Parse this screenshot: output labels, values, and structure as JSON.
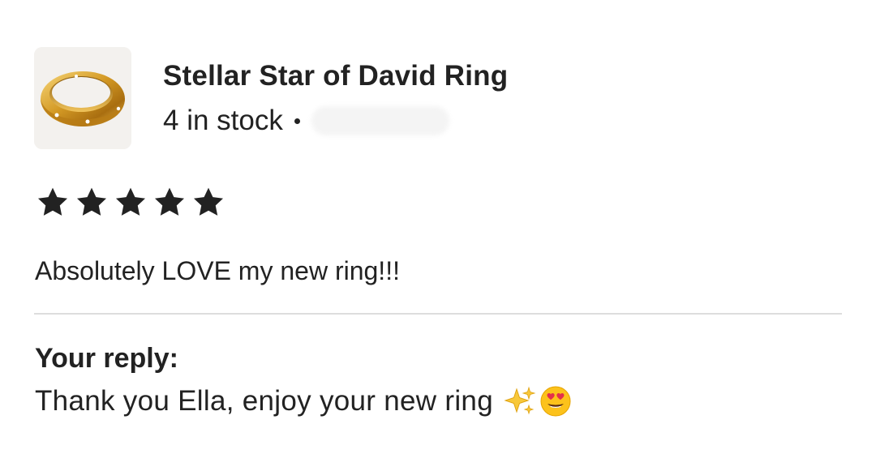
{
  "product": {
    "title": "Stellar Star of David Ring",
    "stock_text": "4 in stock",
    "image_icon": "gold-ring-icon"
  },
  "review": {
    "rating": 5,
    "max_rating": 5,
    "text": "Absolutely LOVE my new ring!!!"
  },
  "reply": {
    "heading": "Your reply:",
    "text": "Thank you Ella, enjoy your new ring",
    "emojis": [
      "sparkles-emoji",
      "heart-eyes-emoji"
    ]
  },
  "colors": {
    "text": "#222222",
    "star": "#222222",
    "divider": "#dddddd",
    "gold": "#d4a02a"
  }
}
